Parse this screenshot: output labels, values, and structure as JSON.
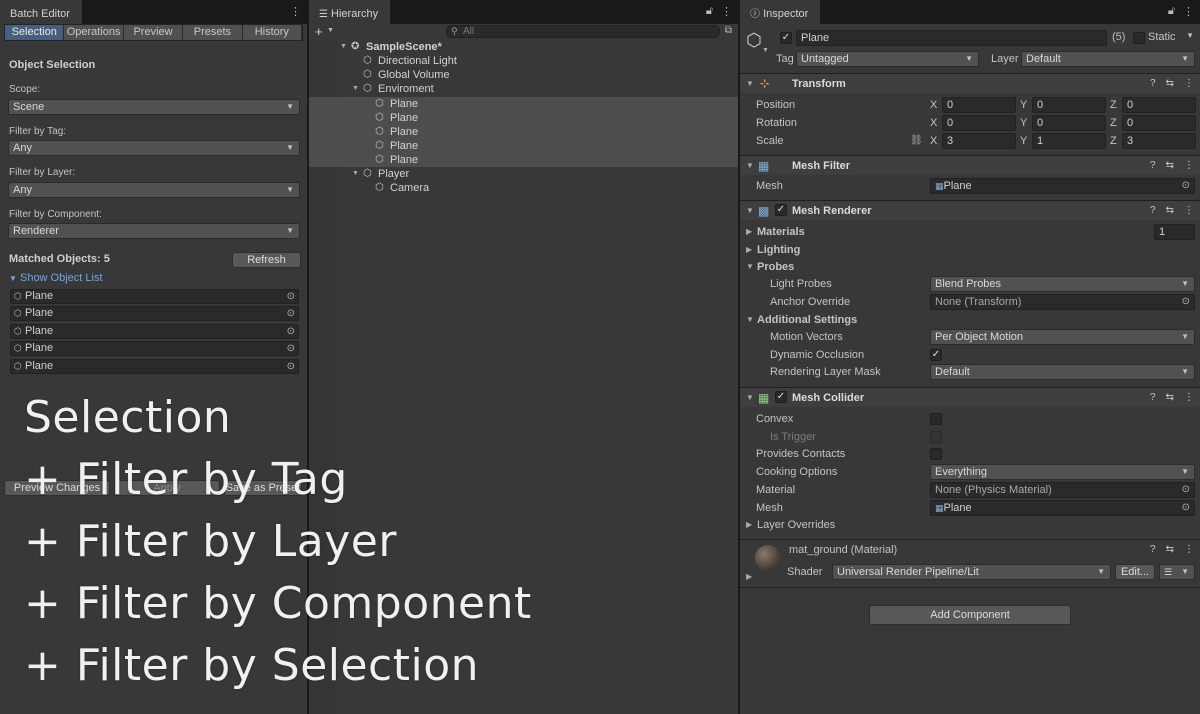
{
  "batch_editor": {
    "tab_title": "Batch Editor",
    "subtabs": [
      "Selection",
      "Operations",
      "Preview",
      "Presets",
      "History"
    ],
    "section_title": "Object Selection",
    "scope_label": "Scope:",
    "scope_value": "Scene",
    "tag_label": "Filter by Tag:",
    "tag_value": "Any",
    "layer_label": "Filter by Layer:",
    "layer_value": "Any",
    "component_label": "Filter by Component:",
    "component_value": "Renderer",
    "matched_label": "Matched Objects: 5",
    "refresh_label": "Refresh",
    "show_list_label": "Show Object List",
    "objects": [
      "Plane",
      "Plane",
      "Plane",
      "Plane",
      "Plane"
    ],
    "footer_buttons": [
      "Preview Changes",
      "Apply",
      "Save as Preset"
    ]
  },
  "overlay": {
    "lines": [
      "Selection",
      "+ Filter by Tag",
      "+ Filter by Layer",
      "+ Filter by Component",
      "+ Filter by Selection"
    ]
  },
  "hierarchy": {
    "tab_title": "Hierarchy",
    "search_placeholder": "All",
    "scene": "SampleScene*",
    "items": [
      {
        "label": "Directional Light"
      },
      {
        "label": "Global Volume"
      },
      {
        "label": "Enviroment"
      },
      {
        "label": "Plane"
      },
      {
        "label": "Plane"
      },
      {
        "label": "Plane"
      },
      {
        "label": "Plane"
      },
      {
        "label": "Plane"
      },
      {
        "label": "Player"
      },
      {
        "label": "Camera"
      }
    ]
  },
  "inspector": {
    "tab_title": "Inspector",
    "object_name": "Plane",
    "count": "(5)",
    "static_label": "Static",
    "tag_label": "Tag",
    "tag_value": "Untagged",
    "layer_label": "Layer",
    "layer_value": "Default",
    "transform": {
      "title": "Transform",
      "position_label": "Position",
      "rotation_label": "Rotation",
      "scale_label": "Scale",
      "axes": [
        "X",
        "Y",
        "Z"
      ],
      "position": [
        "0",
        "0",
        "0"
      ],
      "rotation": [
        "0",
        "0",
        "0"
      ],
      "scale": [
        "3",
        "1",
        "3"
      ]
    },
    "mesh_filter": {
      "title": "Mesh Filter",
      "mesh_label": "Mesh",
      "mesh_value": "Plane"
    },
    "mesh_renderer": {
      "title": "Mesh Renderer",
      "materials_label": "Materials",
      "materials_count": "1",
      "lighting_label": "Lighting",
      "probes_label": "Probes",
      "light_probes_label": "Light Probes",
      "light_probes_value": "Blend Probes",
      "anchor_override_label": "Anchor Override",
      "anchor_override_value": "None (Transform)",
      "additional_label": "Additional Settings",
      "motion_vectors_label": "Motion Vectors",
      "motion_vectors_value": "Per Object Motion",
      "dynamic_occlusion_label": "Dynamic Occlusion",
      "rendering_layer_label": "Rendering Layer Mask",
      "rendering_layer_value": "Default"
    },
    "mesh_collider": {
      "title": "Mesh Collider",
      "convex_label": "Convex",
      "is_trigger_label": "Is Trigger",
      "provides_contacts_label": "Provides Contacts",
      "cooking_label": "Cooking Options",
      "cooking_value": "Everything",
      "material_label": "Material",
      "material_value": "None (Physics Material)",
      "mesh_label": "Mesh",
      "mesh_value": "Plane",
      "overrides_label": "Layer Overrides"
    },
    "material": {
      "name": "mat_ground (Material)",
      "shader_label": "Shader",
      "shader_value": "Universal Render Pipeline/Lit",
      "edit_label": "Edit..."
    },
    "add_component_label": "Add Component"
  },
  "colors": {
    "accent": "#46607c",
    "link": "#6ba8e8",
    "panel_bg": "#383838"
  }
}
